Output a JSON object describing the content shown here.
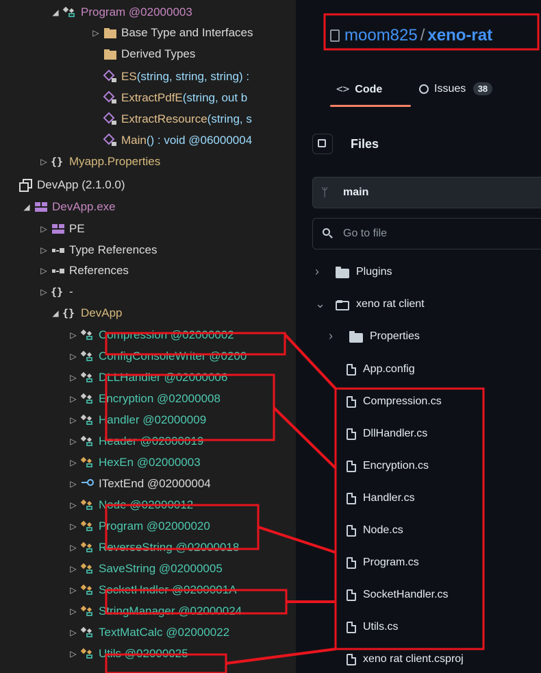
{
  "tree": {
    "rows": [
      {
        "label": "Program @02000003",
        "arrow": "◢",
        "icon": "class",
        "color": "purple"
      },
      {
        "label": "Base Type and Interfaces",
        "arrow": "▷",
        "icon": "folder",
        "color": "white"
      },
      {
        "label": "Derived Types",
        "arrow": "",
        "icon": "folder",
        "color": "white"
      },
      {
        "label": "ES",
        "sig": "(string, string, string) :",
        "arrow": "",
        "icon": "method",
        "color": "gold"
      },
      {
        "label": "ExtractPdfE",
        "sig": "(string, out b",
        "arrow": "",
        "icon": "method",
        "color": "gold"
      },
      {
        "label": "ExtractResource",
        "sig": "(string, s",
        "arrow": "",
        "icon": "method",
        "color": "gold"
      },
      {
        "label": "Main",
        "sig": "() : void @06000004",
        "arrow": "",
        "icon": "method",
        "color": "gold"
      },
      {
        "label": "Myapp.Properties",
        "arrow": "▷",
        "icon": "namespace",
        "color": "ns"
      },
      {
        "label": "DevApp (2.1.0.0)",
        "arrow": "",
        "icon": "assembly",
        "color": "white"
      },
      {
        "label": "DevApp.exe",
        "arrow": "◢",
        "icon": "module",
        "color": "purple"
      },
      {
        "label": "PE",
        "arrow": "▷",
        "icon": "module",
        "color": "white"
      },
      {
        "label": "Type References",
        "arrow": "▷",
        "icon": "refs",
        "color": "white"
      },
      {
        "label": "References",
        "arrow": "▷",
        "icon": "refs",
        "color": "white"
      },
      {
        "label": "-",
        "arrow": "▷",
        "icon": "namespace",
        "color": "white"
      },
      {
        "label": "DevApp",
        "arrow": "◢",
        "icon": "namespace",
        "color": "ns"
      },
      {
        "label": "Compression @02000002",
        "arrow": "▷",
        "icon": "class",
        "color": "teal"
      },
      {
        "label": "ConfigConsoleWriter @0200",
        "arrow": "▷",
        "icon": "class",
        "color": "teal"
      },
      {
        "label": "DLLHandler @02000006",
        "arrow": "▷",
        "icon": "class",
        "color": "teal"
      },
      {
        "label": "Encryption @02000008",
        "arrow": "▷",
        "icon": "class",
        "color": "teal"
      },
      {
        "label": "Handler @02000009",
        "arrow": "▷",
        "icon": "class",
        "color": "teal"
      },
      {
        "label": "Header @02000019",
        "arrow": "▷",
        "icon": "class",
        "color": "teal"
      },
      {
        "label": "HexEn @02000003",
        "arrow": "▷",
        "icon": "class-static",
        "color": "teal"
      },
      {
        "label": "ITextEnd @02000004",
        "arrow": "▷",
        "icon": "interface",
        "color": "white"
      },
      {
        "label": "Node @02000012",
        "arrow": "▷",
        "icon": "class-static",
        "color": "teal"
      },
      {
        "label": "Program @02000020",
        "arrow": "▷",
        "icon": "class-static",
        "color": "teal"
      },
      {
        "label": "ReverseString @02000018",
        "arrow": "▷",
        "icon": "class-static",
        "color": "teal"
      },
      {
        "label": "SaveString @02000005",
        "arrow": "▷",
        "icon": "class-static",
        "color": "teal"
      },
      {
        "label": "SocketHndler @0200001A",
        "arrow": "▷",
        "icon": "class-static",
        "color": "teal"
      },
      {
        "label": "StringManager @02000024",
        "arrow": "▷",
        "icon": "class-static",
        "color": "teal"
      },
      {
        "label": "TextMatCalc @02000022",
        "arrow": "▷",
        "icon": "class",
        "color": "teal"
      },
      {
        "label": "Utils @02000025",
        "arrow": "▷",
        "icon": "class-static",
        "color": "teal"
      }
    ]
  },
  "github": {
    "owner": "moom825",
    "separator": "/",
    "repo": "xeno-rat",
    "tab_code": "Code",
    "tab_issues": "Issues",
    "issues_count": "38",
    "files_title": "Files",
    "branch": "main",
    "search_placeholder": "Go to file",
    "entries": [
      {
        "name": "Plugins",
        "type": "folder",
        "expander": "›"
      },
      {
        "name": "xeno rat client",
        "type": "folder-open",
        "expander": "⌄"
      },
      {
        "name": "Properties",
        "type": "folder",
        "expander": "›"
      },
      {
        "name": "App.config",
        "type": "file",
        "expander": ""
      },
      {
        "name": "Compression.cs",
        "type": "file",
        "expander": ""
      },
      {
        "name": "DllHandler.cs",
        "type": "file",
        "expander": ""
      },
      {
        "name": "Encryption.cs",
        "type": "file",
        "expander": ""
      },
      {
        "name": "Handler.cs",
        "type": "file",
        "expander": ""
      },
      {
        "name": "Node.cs",
        "type": "file",
        "expander": ""
      },
      {
        "name": "Program.cs",
        "type": "file",
        "expander": ""
      },
      {
        "name": "SocketHandler.cs",
        "type": "file",
        "expander": ""
      },
      {
        "name": "Utils.cs",
        "type": "file",
        "expander": ""
      },
      {
        "name": "xeno rat client.csproj",
        "type": "file",
        "expander": ""
      }
    ]
  },
  "colors": {
    "highlight": "#e8141d",
    "teal": "#4ec9b0",
    "accent_link": "#4493f8"
  }
}
